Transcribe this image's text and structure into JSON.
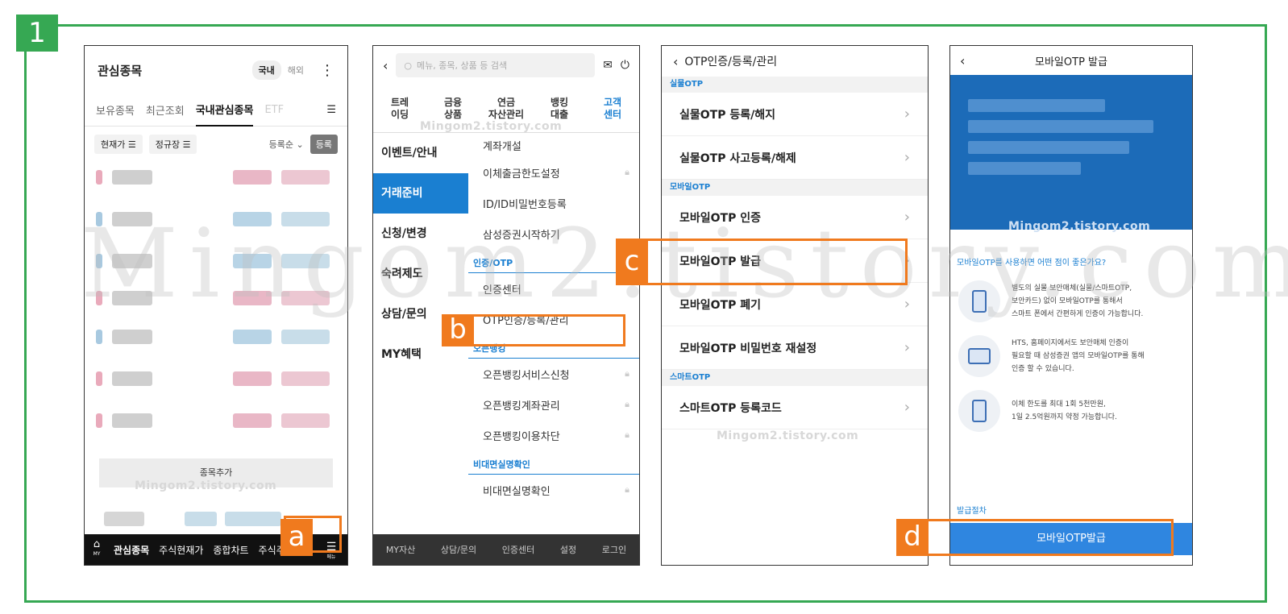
{
  "step": "1",
  "watermark": "Mingom2.tistory.com",
  "phone1": {
    "title": "관심종목",
    "toggle": [
      "국내",
      "해외"
    ],
    "tabs": [
      "보유종목",
      "최근조회",
      "국내관심종목",
      "ETF"
    ],
    "filters": [
      "현재가",
      "정규장"
    ],
    "sort": "등록순",
    "register": "등록",
    "add_button": "종목추가",
    "bottom_nav": [
      "관심종목",
      "주식현재가",
      "종합차트",
      "주식주"
    ],
    "home_label": "MY",
    "menu_label": "메뉴",
    "callout": "a"
  },
  "phone2": {
    "search_placeholder": "메뉴, 종목, 상품 등 검색",
    "categories": [
      "트레\n이딩",
      "금융\n상품",
      "연금\n자산관리",
      "뱅킹\n대출",
      "고객\n센터"
    ],
    "left_nav": [
      "이벤트/안내",
      "거래준비",
      "신청/변경",
      "숙려제도",
      "상담/문의",
      "MY혜택"
    ],
    "items_top": [
      "계좌개설",
      "이체출금한도설정",
      "ID/ID비밀번호등록",
      "삼성증권시작하기"
    ],
    "section_otp": "인증/OTP",
    "items_otp": [
      "인증센터",
      "OTP인증/등록/관리"
    ],
    "section_open": "오픈뱅킹",
    "items_open": [
      "오픈뱅킹서비스신청",
      "오픈뱅킹계좌관리",
      "오픈뱅킹이용차단"
    ],
    "section_nf": "비대면실명확인",
    "items_nf": [
      "비대면실명확인"
    ],
    "bottom_nav": [
      "MY자산",
      "상담/문의",
      "인증센터",
      "설정",
      "로그인"
    ],
    "callout": "b"
  },
  "phone3": {
    "title": "OTP인증/등록/관리",
    "section_hw": "실물OTP",
    "hw_items": [
      "실물OTP 등록/해지",
      "실물OTP 사고등록/해제"
    ],
    "section_mobile": "모바일OTP",
    "mobile_items": [
      "모바일OTP 인증",
      "모바일OTP 발급",
      "모바일OTP 폐기",
      "모바일OTP 비밀번호 재설정"
    ],
    "section_smart": "스마트OTP",
    "smart_items": [
      "스마트OTP 등록코드"
    ],
    "callout": "c"
  },
  "phone4": {
    "title": "모바일OTP 발급",
    "question": "모바일OTP를 사용하면 어떤 점이 좋은가요?",
    "features": [
      "별도의 실물 보안매체(실물/스마트OTP,\n보안카드) 없이 모바일OTP를 통해서\n스마트 폰에서 간편하게 인증이 가능합니다.",
      "HTS, 홈페이지에서도 보안매체 인증이\n필요할 때 삼성증권 앱의 모바일OTP를 통해\n인증 할 수 있습니다.",
      "이체 한도를 최대 1회 5천만원,\n1일 2.5억원까지 약정 가능합니다."
    ],
    "procedure": "발급절차",
    "issue_button": "모바일OTP발급",
    "callout": "d"
  }
}
